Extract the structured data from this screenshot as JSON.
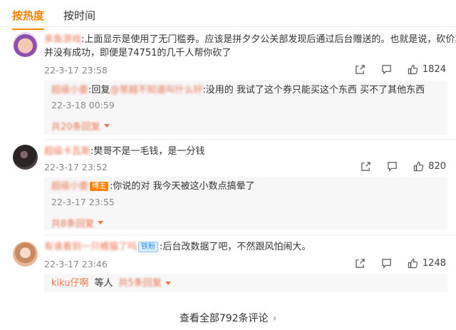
{
  "tabs": {
    "hot": "按热度",
    "time": "按时间"
  },
  "comments": [
    {
      "user": "亲鱼游戏",
      "text_line1": ":上面显示是使用了无门槛券。应该是拼夕夕公关部发现后通过后台赠送的。也就是说，砍价其实",
      "text_line2": "并没有成功，即便是74751的几千人帮你砍了",
      "time": "22-3-17 23:58",
      "likes": "1824",
      "reply": {
        "user": "超级小委",
        "prefix": ":回复",
        "mention": "@常越不知道叫什么好",
        "text": ":没用的 我试了这个券只能买这个东西 买不了其他东西",
        "time": "22-3-18 00:59",
        "more": "共20条回复"
      }
    },
    {
      "user": "超级卡瓦斯",
      "text_line1": ":樊哥不是一毛钱，是一分钱",
      "time": "22-3-17 23:52",
      "likes": "820",
      "reply": {
        "user": "超级小委",
        "badge": "博主",
        "text": ":你说的对 我今天被这小数点搞晕了",
        "time": "22-3-17 23:55",
        "more": "共8条回复"
      }
    },
    {
      "user": "有谁看到一只橘猫了吗",
      "badge": "铁粉",
      "text_line1": ":后台改数据了吧，不然跟风怕闹大。",
      "time": "22-3-17 23:46",
      "likes": "1248",
      "reply": {
        "user": "kiku仔啊",
        "text": "等人",
        "more": "共5条回复"
      }
    }
  ],
  "footer": {
    "view_all": "查看全部792条评论",
    "chevron": "›"
  },
  "colors": {
    "accent": "#ff8200",
    "username": "#eb7350"
  },
  "icons": [
    "share-icon",
    "comment-icon",
    "like-icon",
    "chevron-down-icon",
    "chevron-right-icon"
  ]
}
